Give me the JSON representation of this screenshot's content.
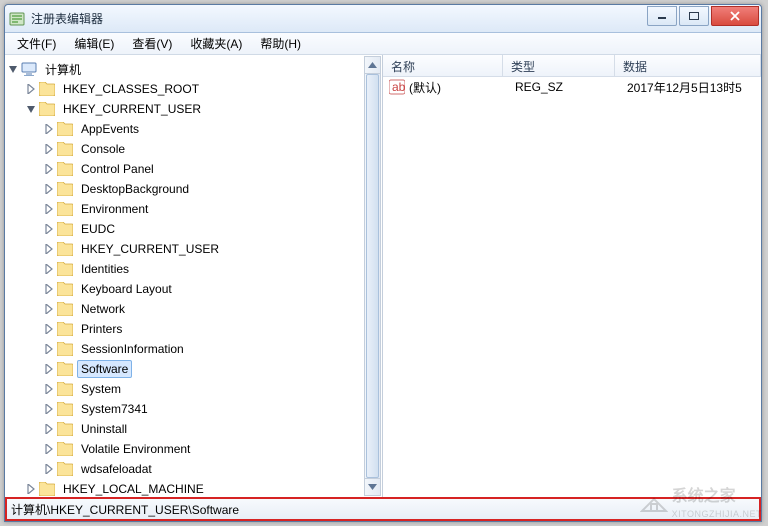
{
  "window": {
    "title": "注册表编辑器"
  },
  "menu": {
    "file": "文件(F)",
    "edit": "编辑(E)",
    "view": "查看(V)",
    "fav": "收藏夹(A)",
    "help": "帮助(H)"
  },
  "tree": {
    "root": "计算机",
    "hkcr": "HKEY_CLASSES_ROOT",
    "hkcu": "HKEY_CURRENT_USER",
    "hklm": "HKEY_LOCAL_MACHINE",
    "children": [
      "AppEvents",
      "Console",
      "Control Panel",
      "DesktopBackground",
      "Environment",
      "EUDC",
      "HKEY_CURRENT_USER",
      "Identities",
      "Keyboard Layout",
      "Network",
      "Printers",
      "SessionInformation",
      "Software",
      "System",
      "System7341",
      "Uninstall",
      "Volatile Environment",
      "wdsafeloadat"
    ],
    "selected_index": 12
  },
  "list": {
    "cols": {
      "name": "名称",
      "type": "类型",
      "data": "数据"
    },
    "rows": [
      {
        "name": "(默认)",
        "type": "REG_SZ",
        "data": "2017年12月5日13时5"
      }
    ]
  },
  "status": {
    "path": "计算机\\HKEY_CURRENT_USER\\Software"
  },
  "watermark": {
    "text": "系统之家",
    "url": "XITONGZHIJIA.NET"
  }
}
